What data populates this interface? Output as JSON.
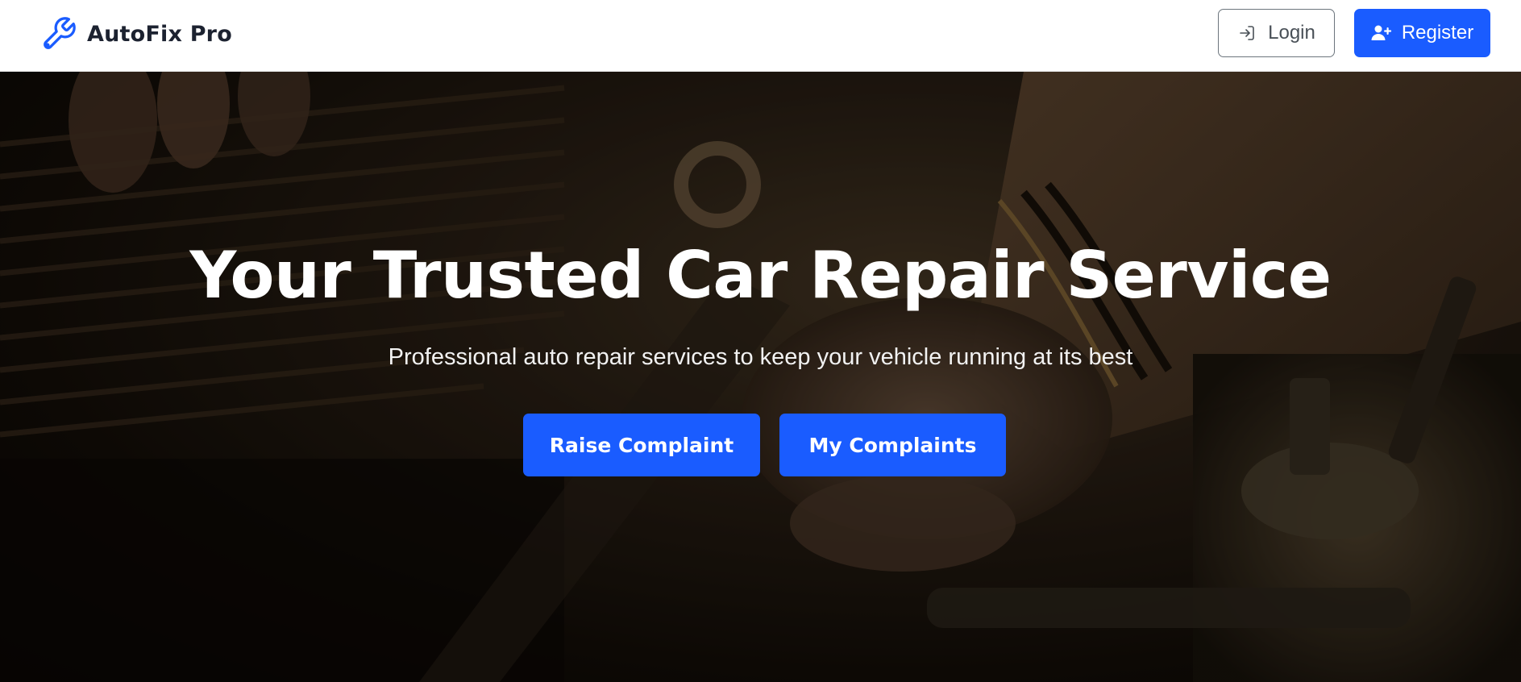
{
  "brand": {
    "name": "AutoFix Pro",
    "icon": "wrench-icon",
    "accent_color": "#1a5cff"
  },
  "nav": {
    "login_label": "Login",
    "login_icon": "login-arrow-icon",
    "register_label": "Register",
    "register_icon": "user-plus-icon"
  },
  "hero": {
    "title": "Your Trusted Car Repair Service",
    "subtitle": "Professional auto repair services to keep your vehicle running at its best",
    "raise_complaint_label": "Raise Complaint",
    "my_complaints_label": "My Complaints",
    "background": "mechanic-working-on-engine-photo"
  },
  "colors": {
    "primary": "#1a5cff",
    "navbar_bg": "#ffffff",
    "brand_text": "#1c2230",
    "hero_text": "#ffffff"
  }
}
